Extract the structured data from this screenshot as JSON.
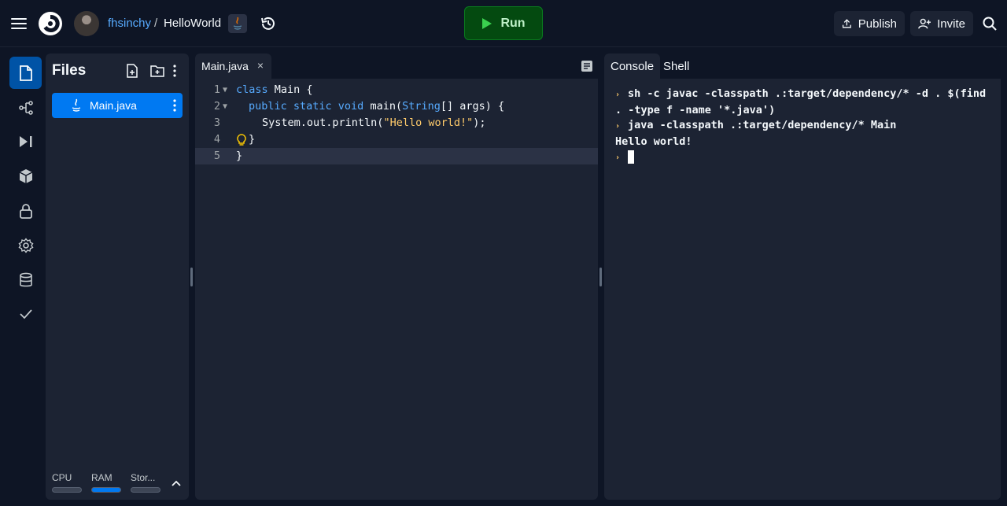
{
  "topbar": {
    "owner": "fhsinchy",
    "separator": "/",
    "repl_name": "HelloWorld",
    "run_label": "Run",
    "publish_label": "Publish",
    "invite_label": "Invite"
  },
  "leftnav": {
    "items": [
      "files-icon",
      "git-icon",
      "debugger-icon",
      "packages-icon",
      "secrets-icon",
      "settings-icon",
      "database-icon",
      "unit-tests-icon"
    ]
  },
  "files": {
    "title": "Files",
    "items": [
      {
        "name": "Main.java",
        "icon": "java-icon"
      }
    ],
    "resources": {
      "cpu": {
        "label": "CPU",
        "level": 0
      },
      "ram": {
        "label": "RAM",
        "level": 1.0
      },
      "storage": {
        "label": "Stor...",
        "level": 0
      }
    }
  },
  "editor": {
    "tab": "Main.java",
    "close": "×",
    "lines": [
      {
        "n": "1",
        "fold": "▼"
      },
      {
        "n": "2",
        "fold": "▼"
      },
      {
        "n": "3",
        "fold": ""
      },
      {
        "n": "4",
        "fold": ""
      },
      {
        "n": "5",
        "fold": ""
      }
    ],
    "code": {
      "l1_kw": "class",
      "l1_rest": " Main {",
      "l2_kw": "public static void",
      "l2_m": " main(",
      "l2_type": "String",
      "l2_rest": "[] args) {",
      "l3_a": "System.out.println(",
      "l3_str": "\"Hello world!\"",
      "l3_b": ");",
      "l4": "}",
      "l5": "}"
    }
  },
  "console": {
    "tabs": [
      "Console",
      "Shell"
    ],
    "prompt_glyph": "›",
    "cmd1": "sh -c javac -classpath .:target/dependency/* -d . $(find",
    "cmd1_cont": ". -type f -name '*.java')",
    "cmd2": "java -classpath .:target/dependency/* Main",
    "output": "Hello world!"
  },
  "colors": {
    "background": "#0e1525",
    "panel": "#1c2333",
    "accent": "#0079f2",
    "run_button": "#044a10",
    "string": "#ffcb6b",
    "keyword": "#57abff"
  }
}
